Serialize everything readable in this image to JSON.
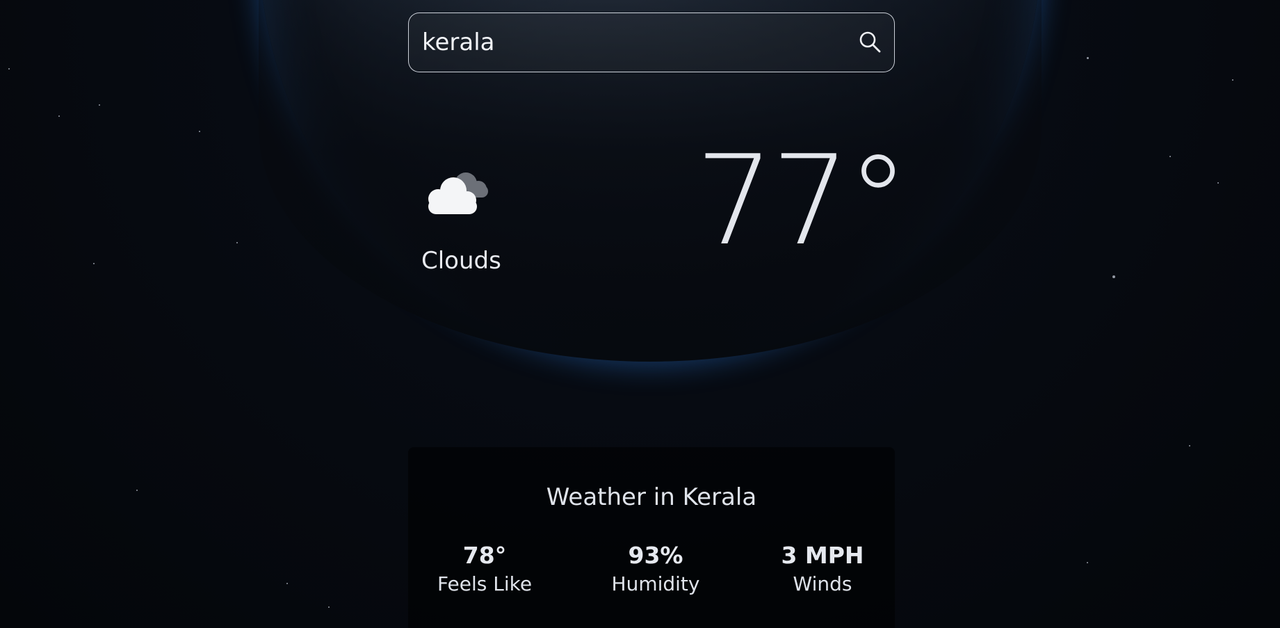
{
  "search": {
    "value": "kerala",
    "icon": "search-icon"
  },
  "current": {
    "condition": "Clouds",
    "condition_icon": "cloud-icon",
    "temperature": "77°"
  },
  "details": {
    "title": "Weather in Kerala",
    "stats": [
      {
        "value": "78°",
        "label": "Feels Like"
      },
      {
        "value": "93%",
        "label": "Humidity"
      },
      {
        "value": "3 MPH",
        "label": "Winds"
      }
    ]
  },
  "colors": {
    "background": "#05070b",
    "text": "#e6e8ee",
    "atmosphere": "#3a7ad0"
  }
}
